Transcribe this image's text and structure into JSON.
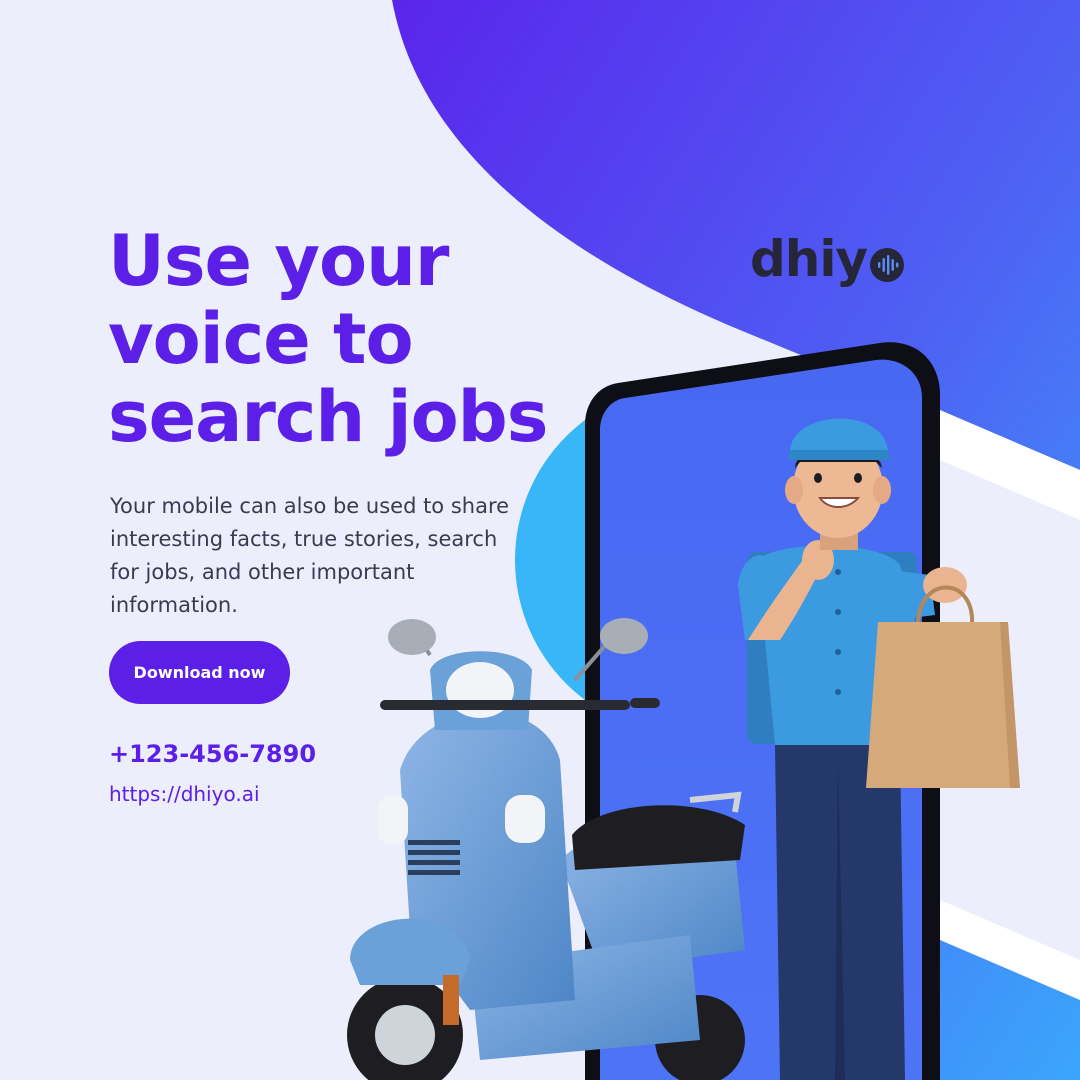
{
  "headline": {
    "line1": "Use your",
    "line2": "voice to",
    "line3": "search jobs"
  },
  "body_text": "Your mobile can also be used to share interesting facts, true stories, search for jobs, and other important information.",
  "cta": {
    "label": "Download now"
  },
  "contact": {
    "phone": "+123-456-7890",
    "website": "https://dhiyo.ai"
  },
  "brand": {
    "name": "dhiy"
  },
  "colors": {
    "accent": "#5b1fe8",
    "background": "#eceefb",
    "brand_text": "#26263a"
  }
}
